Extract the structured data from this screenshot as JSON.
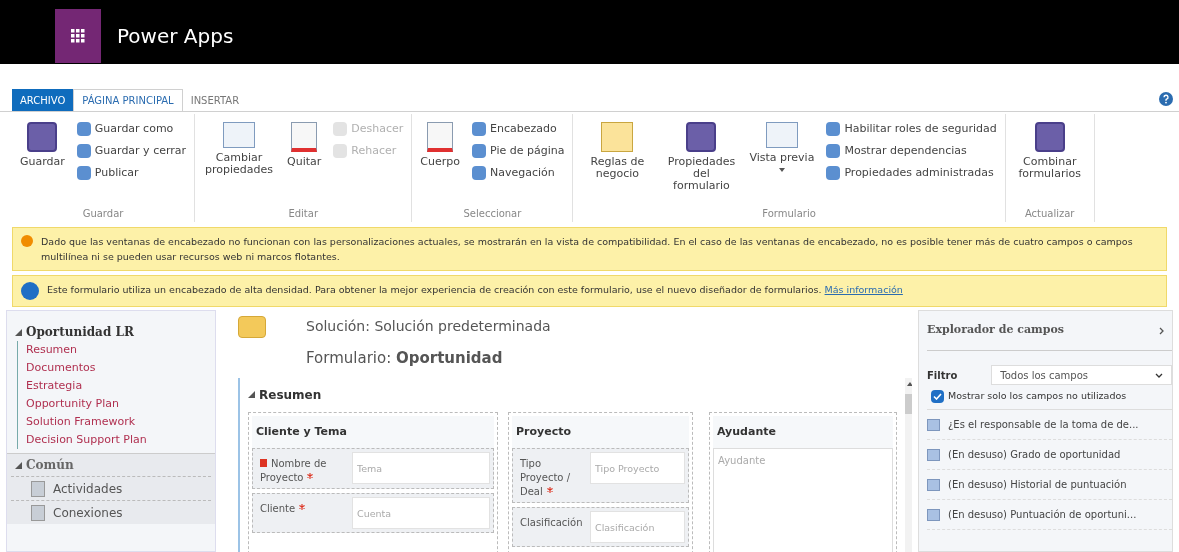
{
  "app": {
    "title": "Power Apps"
  },
  "tabs": [
    {
      "label": "ARCHIVO",
      "kind": "file",
      "selected": false
    },
    {
      "label": "PÁGINA PRINCIPAL",
      "kind": "tab",
      "selected": true
    },
    {
      "label": "INSERTAR",
      "kind": "tab",
      "selected": false
    }
  ],
  "ribbon": [
    {
      "label": "Guardar",
      "buttons": [
        {
          "kind": "large",
          "label": "Guardar",
          "disabled": false
        },
        {
          "kind": "small",
          "label": "Guardar como",
          "disabled": false
        },
        {
          "kind": "small",
          "label": "Guardar y cerrar",
          "disabled": false
        },
        {
          "kind": "small",
          "label": "Publicar",
          "disabled": false
        }
      ]
    },
    {
      "label": "Editar",
      "buttons": [
        {
          "kind": "large",
          "label": "Cambiar propiedades",
          "disabled": false
        },
        {
          "kind": "large",
          "label": "Quitar",
          "disabled": false
        },
        {
          "kind": "small",
          "label": "Deshacer",
          "disabled": true
        },
        {
          "kind": "small",
          "label": "Rehacer",
          "disabled": true
        }
      ]
    },
    {
      "label": "Seleccionar",
      "buttons": [
        {
          "kind": "large",
          "label": "Cuerpo",
          "disabled": false
        },
        {
          "kind": "small",
          "label": "Encabezado",
          "disabled": false
        },
        {
          "kind": "small",
          "label": "Pie de página",
          "disabled": false
        },
        {
          "kind": "small",
          "label": "Navegación",
          "disabled": false
        }
      ]
    },
    {
      "label": "Formulario",
      "buttons": [
        {
          "kind": "large",
          "label": "Reglas de negocio",
          "disabled": false
        },
        {
          "kind": "large",
          "label": "Propiedades del formulario",
          "disabled": false
        },
        {
          "kind": "dropdown",
          "label": "Vista previa",
          "disabled": false
        },
        {
          "kind": "small",
          "label": "Habilitar roles de seguridad",
          "disabled": false
        },
        {
          "kind": "small",
          "label": "Mostrar dependencias",
          "disabled": false
        },
        {
          "kind": "small",
          "label": "Propiedades administradas",
          "disabled": false
        }
      ]
    },
    {
      "label": "Actualizar",
      "buttons": [
        {
          "kind": "large",
          "label": "Combinar formularios",
          "disabled": false
        }
      ]
    }
  ],
  "alerts": [
    {
      "kind": "warning",
      "text": "Dado que las ventanas de encabezado no funcionan con las personalizaciones actuales, se mostrarán en la vista de compatibilidad. En el caso de las ventanas de encabezado, no es posible tener más de cuatro campos o campos multilínea ni se pueden usar recursos web ni marcos flotantes."
    },
    {
      "kind": "info",
      "text": "Este formulario utiliza un encabezado de alta densidad. Para obtener la mejor experiencia de creación con este formulario, use el nuevo diseñador de formularios.",
      "link": "Más información"
    }
  ],
  "nav": [
    {
      "title": "Oportunidad LR",
      "expanded": true,
      "kind": "links",
      "items": [
        "Resumen",
        "Documentos",
        "Estrategia",
        "Opportunity Plan",
        "Solution Framework",
        "Decision Support Plan"
      ]
    },
    {
      "title": "Común",
      "expanded": true,
      "kind": "entries",
      "items": [
        "Actividades",
        "Conexiones"
      ]
    }
  ],
  "canvas": {
    "solution": "Solución: Solución predeterminada",
    "form": "Formulario: **Oportunidad**",
    "section": {
      "title": "Resumen",
      "expanded": true,
      "columns": [
        {
          "title": "Cliente y Tema",
          "kind": "fields",
          "fields": [
            {
              "label": "Nombre de Proyecto",
              "required": true,
              "locked": true,
              "placeholder": "Tema"
            },
            {
              "label": "Cliente",
              "required": true,
              "locked": false,
              "placeholder": "Cuenta"
            }
          ]
        },
        {
          "title": "Proyecto",
          "kind": "fields",
          "fields": [
            {
              "label": "Tipo Proyecto / Deal",
              "required": true,
              "locked": false,
              "placeholder": "Tipo Proyecto"
            },
            {
              "label": "Clasificación",
              "required": false,
              "locked": false,
              "placeholder": "Clasificación"
            }
          ]
        },
        {
          "title": "Ayudante",
          "kind": "textarea",
          "placeholder": "Ayudante"
        }
      ]
    }
  },
  "explorer": {
    "title": "Explorador de campos",
    "filter_label": "Filtro",
    "filter_value": "Todos los campos",
    "only_unused": {
      "label": "Mostrar solo los campos no utilizados",
      "checked": true
    },
    "fields": [
      "¿Es el responsable de la toma de de...",
      "(En desuso) Grado de oportunidad",
      "(En desuso) Historial de puntuación",
      "(En desuso) Puntuación de oportuni..."
    ]
  }
}
